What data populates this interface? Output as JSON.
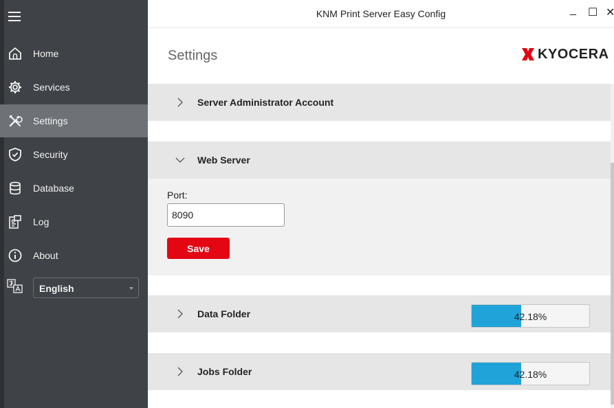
{
  "window": {
    "title": "KNM Print Server Easy Config",
    "minimize_glyph": "_",
    "maximize_glyph": "☐",
    "close_glyph": "✕"
  },
  "sidebar": {
    "items": [
      {
        "label": "Home",
        "icon": "home-icon"
      },
      {
        "label": "Services",
        "icon": "gear-icon"
      },
      {
        "label": "Settings",
        "icon": "tools-icon",
        "active": true
      },
      {
        "label": "Security",
        "icon": "shield-icon"
      },
      {
        "label": "Database",
        "icon": "database-icon"
      },
      {
        "label": "Log",
        "icon": "log-icon"
      },
      {
        "label": "About",
        "icon": "info-icon"
      }
    ],
    "language": {
      "icon": "language-icon",
      "selected": "English"
    }
  },
  "header": {
    "page_title": "Settings",
    "logo_text": "KYOCERA",
    "logo_color": "#e30613"
  },
  "sections": {
    "server_admin": {
      "title": "Server Administrator Account",
      "expanded": false
    },
    "web_server": {
      "title": "Web Server",
      "expanded": true,
      "port_label": "Port:",
      "port_value": "8090",
      "save_label": "Save"
    },
    "data_folder": {
      "title": "Data Folder",
      "expanded": false,
      "usage_text": "42.18%",
      "usage_fraction": 0.4218
    },
    "jobs_folder": {
      "title": "Jobs Folder",
      "expanded": false,
      "usage_text": "42.18%",
      "usage_fraction": 0.4218
    }
  },
  "colors": {
    "sidebar_bg": "#3f4246",
    "sidebar_active": "#6e7277",
    "accent_red": "#e30613",
    "progress_blue": "#1fa3d8"
  }
}
